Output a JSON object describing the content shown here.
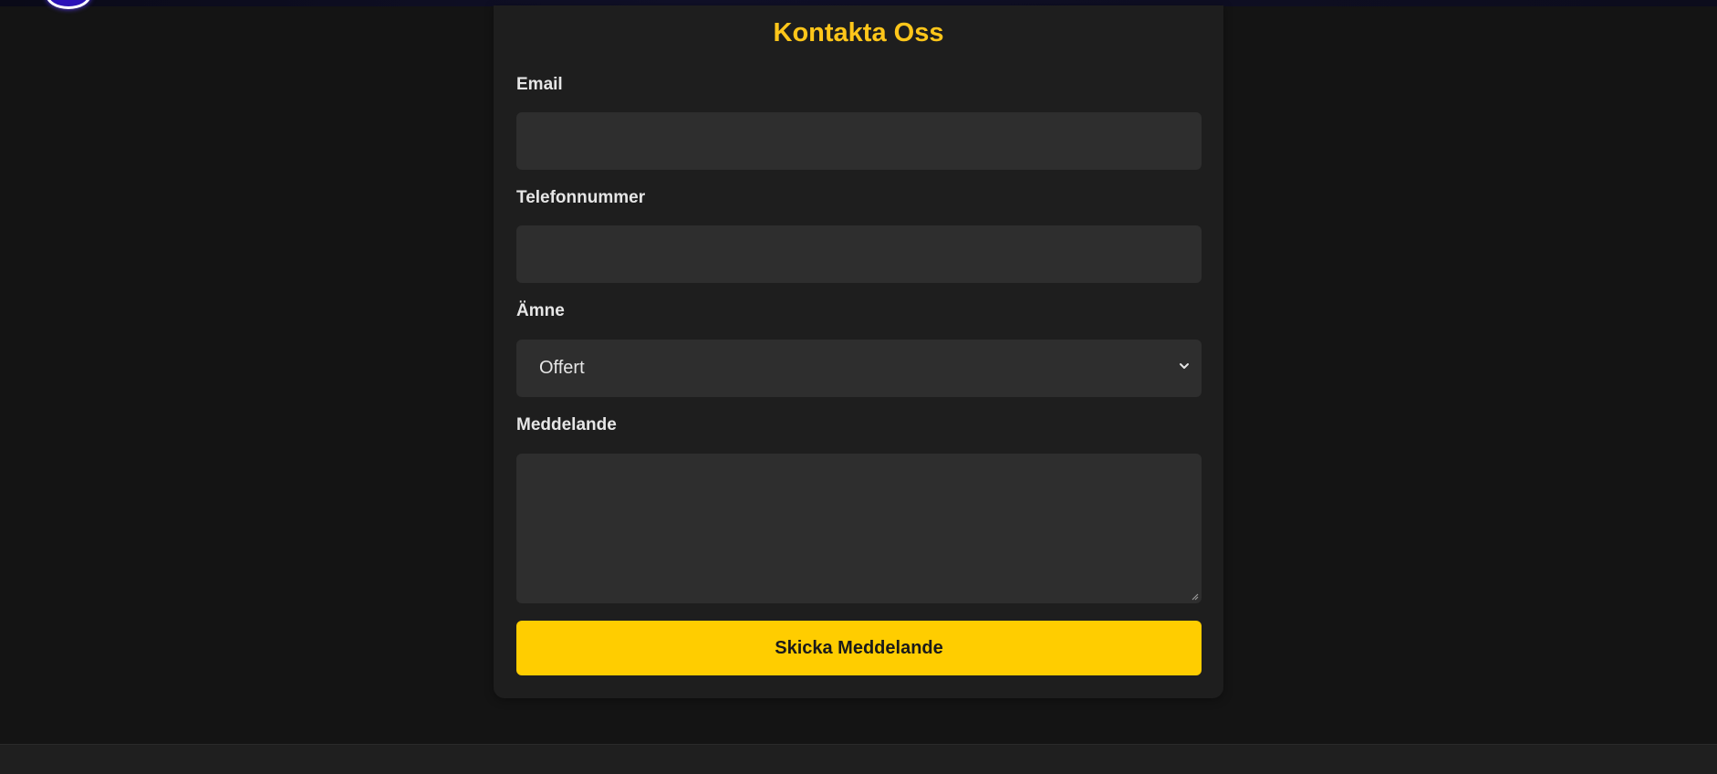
{
  "contact_form": {
    "title": "Kontakta Oss",
    "email": {
      "label": "Email",
      "value": ""
    },
    "phone": {
      "label": "Telefonnummer",
      "value": ""
    },
    "subject": {
      "label": "Ämne",
      "selected": "Offert"
    },
    "message": {
      "label": "Meddelande",
      "value": ""
    },
    "submit_label": "Skicka Meddelande"
  },
  "colors": {
    "accent": "#ffcd00",
    "title": "#ffc61a",
    "background": "#141414",
    "card": "#1e1e1e",
    "field": "#2e2e2e"
  }
}
